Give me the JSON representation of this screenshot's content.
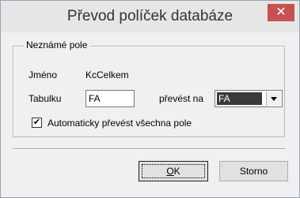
{
  "window": {
    "title": "Převod políček databáze",
    "close_glyph": "✕"
  },
  "group": {
    "legend": "Neznámé pole",
    "name_label": "Jméno",
    "name_value": "KcCelkem",
    "table_label": "Tabulku",
    "table_value": "FA",
    "convert_label": "převést na",
    "convert_value": "FA"
  },
  "checkbox": {
    "label": "Automaticky převést všechna pole",
    "checked": true,
    "check_glyph": "✔"
  },
  "buttons": {
    "ok_mnemonic": "O",
    "ok_rest": "K",
    "cancel": "Storno"
  }
}
